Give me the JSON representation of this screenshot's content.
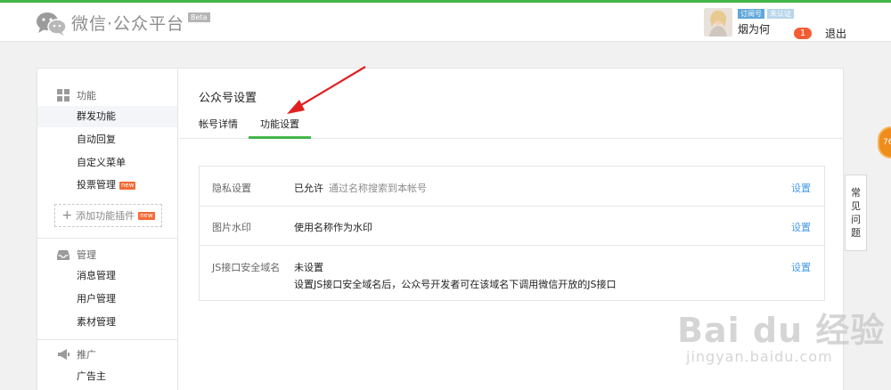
{
  "header": {
    "logo_text": "微信·公众平台",
    "beta_label": "Beta",
    "tag_subscription": "订阅号",
    "tag_unverified": "未认证",
    "username": "烟为何",
    "notification_count": "1",
    "logout": "退出"
  },
  "sidebar": {
    "groups": [
      {
        "title": "功能",
        "items": [
          "群发功能",
          "自动回复",
          "自定义菜单",
          "投票管理"
        ]
      },
      {
        "title": "管理",
        "items": [
          "消息管理",
          "用户管理",
          "素材管理"
        ]
      },
      {
        "title": "推广",
        "items": [
          "广告主"
        ]
      }
    ],
    "new_tag": "new",
    "add_plugin": "添加功能插件"
  },
  "content": {
    "page_title": "公众号设置",
    "tabs": [
      "帐号详情",
      "功能设置"
    ],
    "settings": [
      {
        "label": "隐私设置",
        "value": "已允许",
        "hint": "通过名称搜索到本帐号",
        "action": "设置"
      },
      {
        "label": "图片水印",
        "value": "使用名称作为水印",
        "action": "设置"
      },
      {
        "label": "JS接口安全域名",
        "value": "未设置",
        "detail": "设置JS接口安全域名后，公众号开发者可在该域名下调用微信开放的JS接口",
        "action": "设置"
      }
    ]
  },
  "float_faq": "常见问题",
  "scroll_badge": "76",
  "watermark": {
    "main": "Bai du 经验",
    "sub": "jingyan.baidu.com"
  },
  "colors": {
    "brand_green": "#44b549",
    "link_blue": "#459ae9",
    "badge_red": "#f45d34",
    "arrow_red": "#e02020"
  }
}
